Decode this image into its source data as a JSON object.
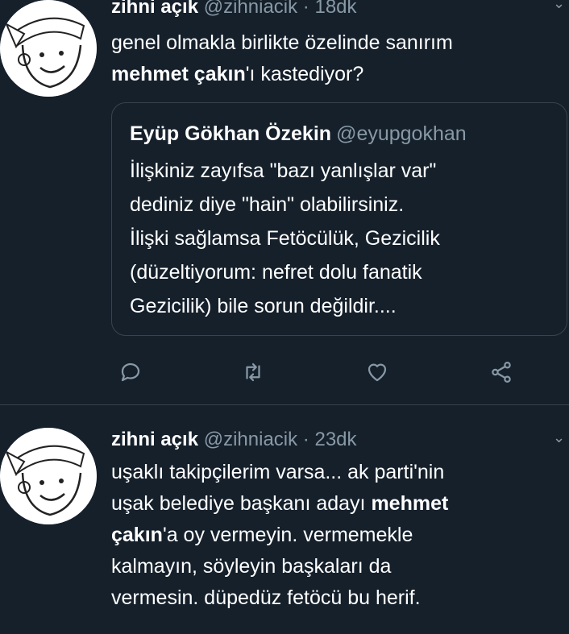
{
  "tweet1": {
    "name": "zihni açık",
    "handle": "@zihniacik",
    "separator": "·",
    "time": "18dk",
    "text_part1": "genel olmakla birlikte özelinde sanırım",
    "text_bold": "mehmet çakın",
    "text_part2": "'ı kastediyor?",
    "quote": {
      "name": "Eyüp Gökhan Özekin",
      "handle": "@eyupgokhan",
      "lines": [
        "İlişkiniz zayıfsa \"bazı yanlışlar var\"",
        "dediniz diye \"hain\" olabilirsiniz.",
        "İlişki sağlamsa Fetöcülük, Gezicilik",
        "(düzeltiyorum: nefret dolu fanatik",
        "Gezicilik) bile sorun değildir...."
      ]
    },
    "actions": [
      "reply-icon",
      "retweet-icon",
      "like-icon",
      "share-icon"
    ]
  },
  "tweet2": {
    "name": "zihni açık",
    "handle": "@zihniacik",
    "separator": "·",
    "time": "23dk",
    "line1": "uşaklı takipçilerim varsa... ak parti'nin",
    "line2_part1": "uşak belediye başkanı adayı ",
    "line2_bold": "mehmet",
    "line3_bold": "çakın",
    "line3_part2": "'a oy vermeyin. vermemekle",
    "line4": "kalmayın, söyleyin başkaları da",
    "line5": "vermesin. düpedüz fetöcü bu herif."
  },
  "colors": {
    "background": "#15202b",
    "secondary_text": "#8899a6",
    "border": "#38444d"
  }
}
